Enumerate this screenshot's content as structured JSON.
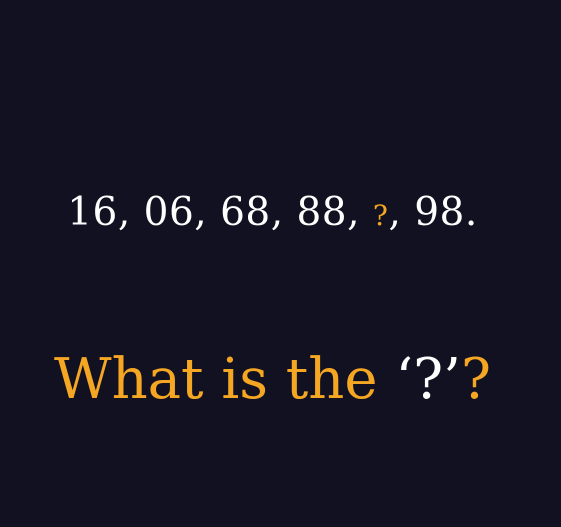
{
  "puzzle": {
    "sequence_before": "16, 06, 68, 88, ",
    "missing_marker": "?",
    "sequence_after": ", 98.",
    "question_prefix": "What is the ",
    "question_quoted": "‘?’",
    "question_suffix": "?"
  },
  "colors": {
    "background": "#121122",
    "text": "#ffffff",
    "accent": "#f5a623"
  }
}
